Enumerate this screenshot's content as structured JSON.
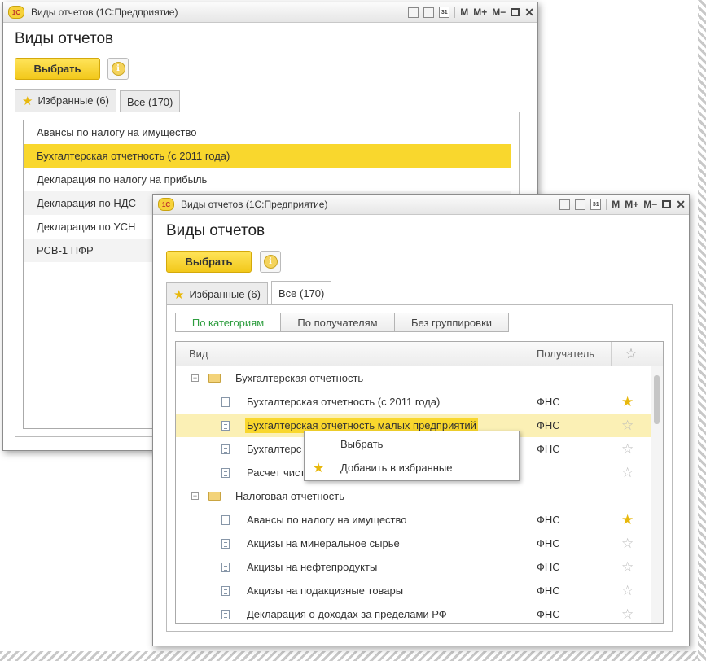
{
  "window_back": {
    "title": "Виды отчетов  (1С:Предприятие)",
    "form_title": "Виды отчетов",
    "select_button": "Выбрать",
    "tabs": [
      {
        "label": "Избранные (6)",
        "active": true,
        "icon": "star-icon"
      },
      {
        "label": "Все (170)",
        "active": false
      }
    ],
    "items": [
      {
        "label": "Авансы по налогу на имущество",
        "selected": false
      },
      {
        "label": "Бухгалтерская отчетность (с 2011 года)",
        "selected": true
      },
      {
        "label": "Декларация по налогу на прибыль",
        "selected": false
      },
      {
        "label": "Декларация по НДС",
        "selected": false
      },
      {
        "label": "Декларация по УСН",
        "selected": false
      },
      {
        "label": "РСВ-1 ПФР",
        "selected": false
      }
    ]
  },
  "window_front": {
    "title": "Виды отчетов  (1С:Предприятие)",
    "form_title": "Виды отчетов",
    "select_button": "Выбрать",
    "tabs": [
      {
        "label": "Избранные (6)",
        "active": false,
        "icon": "star-icon"
      },
      {
        "label": "Все (170)",
        "active": true
      }
    ],
    "grouping_buttons": [
      {
        "label": "По категориям",
        "active": true
      },
      {
        "label": "По получателям",
        "active": false
      },
      {
        "label": "Без группировки",
        "active": false
      }
    ],
    "columns": {
      "name": "Вид",
      "recipient": "Получатель"
    },
    "groups": [
      {
        "label": "Бухгалтерская отчетность",
        "rows": [
          {
            "label": "Бухгалтерская отчетность (с 2011 года)",
            "recipient": "ФНС",
            "favorite": true
          },
          {
            "label": "Бухгалтерская отчетность малых предприятий",
            "recipient": "ФНС",
            "favorite": false,
            "selected": true
          },
          {
            "label": "Бухгалтерс",
            "recipient": "ФНС",
            "favorite": false
          },
          {
            "label": "Расчет чист",
            "recipient": "",
            "favorite": false
          }
        ]
      },
      {
        "label": "Налоговая отчетность",
        "rows": [
          {
            "label": "Авансы по налогу на имущество",
            "recipient": "ФНС",
            "favorite": true
          },
          {
            "label": "Акцизы на минеральное сырье",
            "recipient": "ФНС",
            "favorite": false
          },
          {
            "label": "Акцизы на нефтепродукты",
            "recipient": "ФНС",
            "favorite": false
          },
          {
            "label": "Акцизы на подакцизные товары",
            "recipient": "ФНС",
            "favorite": false
          },
          {
            "label": "Декларация о доходах за пределами РФ",
            "recipient": "ФНС",
            "favorite": false
          }
        ]
      }
    ],
    "context_menu": [
      {
        "label": "Выбрать",
        "icon": ""
      },
      {
        "label": "Добавить в избранные",
        "icon": "star-icon"
      }
    ]
  },
  "colors": {
    "accent_yellow": "#f9d72d",
    "star": "#e8b80c",
    "active_green": "#2e9e3f"
  }
}
